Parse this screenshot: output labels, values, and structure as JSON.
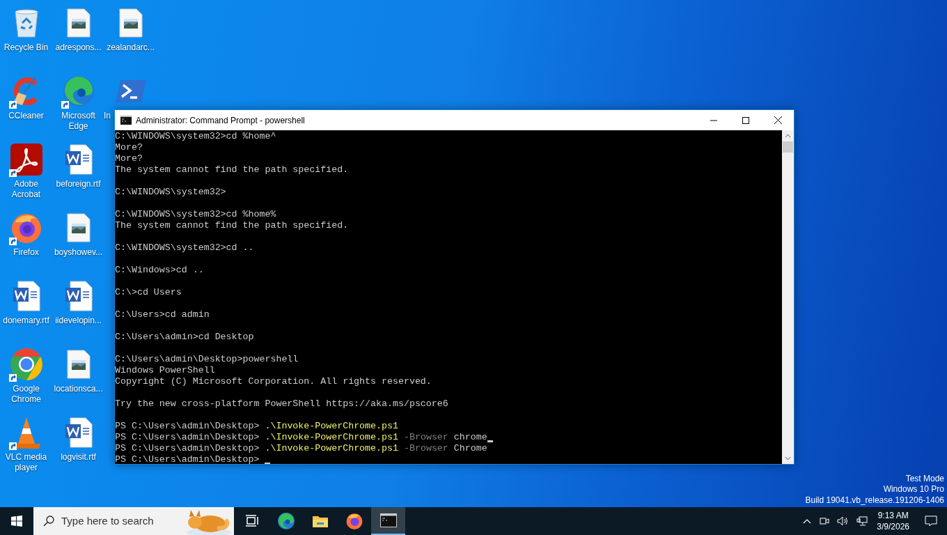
{
  "desktop_icons": [
    {
      "label": "Recycle Bin",
      "kind": "recycle",
      "shortcut": false
    },
    {
      "label": "CCleaner",
      "kind": "ccleaner",
      "shortcut": true
    },
    {
      "label": "Adobe Acrobat",
      "kind": "acrobat",
      "shortcut": true
    },
    {
      "label": "Firefox",
      "kind": "firefox",
      "shortcut": true
    },
    {
      "label": "donemary.rtf",
      "kind": "word",
      "shortcut": false
    },
    {
      "label": "Google Chrome",
      "kind": "chrome",
      "shortcut": true
    },
    {
      "label": "VLC media player",
      "kind": "vlc",
      "shortcut": true
    },
    {
      "label": "adrespons...",
      "kind": "image",
      "shortcut": false
    },
    {
      "label": "Microsoft Edge",
      "kind": "edge",
      "shortcut": true
    },
    {
      "label": "beforeign.rtf",
      "kind": "word",
      "shortcut": false
    },
    {
      "label": "boyshowev...",
      "kind": "image",
      "shortcut": false
    },
    {
      "label": "iidevelopin...",
      "kind": "word",
      "shortcut": false
    },
    {
      "label": "locationsca...",
      "kind": "image",
      "shortcut": false
    },
    {
      "label": "logvisit.rtf",
      "kind": "word",
      "shortcut": false
    },
    {
      "label": "zealandarc...",
      "kind": "image",
      "shortcut": false
    },
    {
      "label": "In",
      "kind": "powershell",
      "shortcut": false
    }
  ],
  "window": {
    "title": "Administrator: Command Prompt - powershell",
    "lines": [
      {
        "kind": "text",
        "segments": [
          {
            "kind": "plain",
            "text": "C:\\WINDOWS\\system32>cd %home^"
          }
        ]
      },
      {
        "kind": "text",
        "segments": [
          {
            "kind": "plain",
            "text": "More?"
          }
        ]
      },
      {
        "kind": "text",
        "segments": [
          {
            "kind": "plain",
            "text": "More?"
          }
        ]
      },
      {
        "kind": "text",
        "segments": [
          {
            "kind": "plain",
            "text": "The system cannot find the path specified."
          }
        ]
      },
      {
        "kind": "blank"
      },
      {
        "kind": "text",
        "segments": [
          {
            "kind": "plain",
            "text": "C:\\WINDOWS\\system32>"
          }
        ]
      },
      {
        "kind": "blank"
      },
      {
        "kind": "text",
        "segments": [
          {
            "kind": "plain",
            "text": "C:\\WINDOWS\\system32>cd %home%"
          }
        ]
      },
      {
        "kind": "text",
        "segments": [
          {
            "kind": "plain",
            "text": "The system cannot find the path specified."
          }
        ]
      },
      {
        "kind": "blank"
      },
      {
        "kind": "text",
        "segments": [
          {
            "kind": "plain",
            "text": "C:\\WINDOWS\\system32>cd .."
          }
        ]
      },
      {
        "kind": "blank"
      },
      {
        "kind": "text",
        "segments": [
          {
            "kind": "plain",
            "text": "C:\\Windows>cd .."
          }
        ]
      },
      {
        "kind": "blank"
      },
      {
        "kind": "text",
        "segments": [
          {
            "kind": "plain",
            "text": "C:\\>cd Users"
          }
        ]
      },
      {
        "kind": "blank"
      },
      {
        "kind": "text",
        "segments": [
          {
            "kind": "plain",
            "text": "C:\\Users>cd admin"
          }
        ]
      },
      {
        "kind": "blank"
      },
      {
        "kind": "text",
        "segments": [
          {
            "kind": "plain",
            "text": "C:\\Users\\admin>cd Desktop"
          }
        ]
      },
      {
        "kind": "blank"
      },
      {
        "kind": "text",
        "segments": [
          {
            "kind": "plain",
            "text": "C:\\Users\\admin\\Desktop>powershell"
          }
        ]
      },
      {
        "kind": "text",
        "segments": [
          {
            "kind": "plain",
            "text": "Windows PowerShell"
          }
        ]
      },
      {
        "kind": "text",
        "segments": [
          {
            "kind": "plain",
            "text": "Copyright (C) Microsoft Corporation. All rights reserved."
          }
        ]
      },
      {
        "kind": "blank"
      },
      {
        "kind": "text",
        "segments": [
          {
            "kind": "plain",
            "text": "Try the new cross-platform PowerShell https://aka.ms/pscore6"
          }
        ]
      },
      {
        "kind": "blank"
      },
      {
        "kind": "text",
        "segments": [
          {
            "kind": "plain",
            "text": "PS C:\\Users\\admin\\Desktop>"
          },
          {
            "kind": "command",
            "text": ".\\Invoke-PowerChrome.ps1"
          }
        ]
      },
      {
        "kind": "text",
        "segments": [
          {
            "kind": "plain",
            "text": "PS C:\\Users\\admin\\Desktop>"
          },
          {
            "kind": "command",
            "text": ".\\Invoke-PowerChrome.ps1"
          },
          {
            "kind": "parameter",
            "text": "-Browser"
          },
          {
            "kind": "plain",
            "text": "chrome"
          }
        ],
        "cursor": true
      },
      {
        "kind": "text",
        "segments": [
          {
            "kind": "plain",
            "text": "PS C:\\Users\\admin\\Desktop>"
          },
          {
            "kind": "command",
            "text": ".\\Invoke-PowerChrome.ps1"
          },
          {
            "kind": "parameter",
            "text": "-Browser"
          },
          {
            "kind": "plain",
            "text": "Chrome"
          }
        ]
      },
      {
        "kind": "text",
        "segments": [
          {
            "kind": "plain",
            "text": "PS C:\\Users\\admin\\Desktop>"
          }
        ],
        "cursor": true
      }
    ]
  },
  "system_info": [
    "Test Mode",
    "Windows 10 Pro",
    "Build 19041.vb_release.191206-1406"
  ],
  "taskbar": {
    "search": {
      "placeholder": "Type here to search"
    },
    "apps": [
      {
        "kind": "taskview",
        "selected": false
      },
      {
        "kind": "edge",
        "selected": false
      },
      {
        "kind": "explorer",
        "selected": false
      },
      {
        "kind": "firefox",
        "selected": false
      },
      {
        "kind": "cmd",
        "selected": true
      }
    ],
    "time": "9:13 AM",
    "date": "3/9/2026"
  }
}
